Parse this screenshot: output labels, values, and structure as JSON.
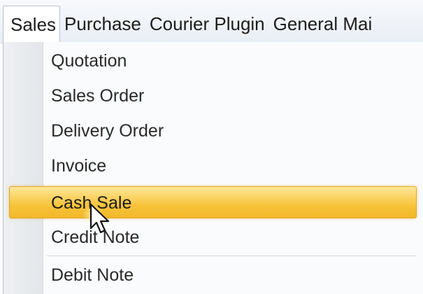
{
  "menubar": {
    "items": [
      "Sales",
      "Purchase",
      "Courier Plugin",
      "General Mai"
    ]
  },
  "dropdown": {
    "items": [
      {
        "label": "Quotation"
      },
      {
        "label": "Sales Order"
      },
      {
        "label": "Delivery Order"
      },
      {
        "label": "Invoice"
      },
      {
        "label": "Cash Sale"
      },
      {
        "label": "Credit Note"
      },
      {
        "label": "Debit Note"
      }
    ],
    "highlighted_index": 4
  },
  "colors": {
    "highlight": "#f7c33a",
    "menubar_bg": "#e9eef5",
    "gutter": "#e6e8eb"
  },
  "cursor": {
    "icon": "mouse-pointer-icon"
  }
}
